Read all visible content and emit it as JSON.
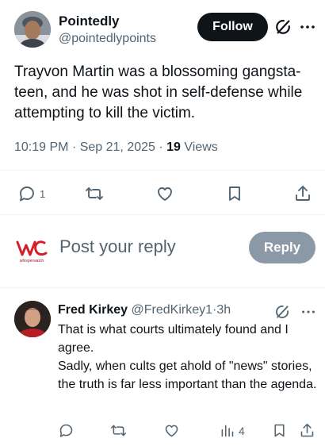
{
  "tweet": {
    "author_name": "Pointedly",
    "author_handle": "@pointedlypoints",
    "follow_label": "Follow",
    "text": "Trayvon Martin was a blossoming gangsta-teen, and he was shot in self-defense while attempting to kill the victim.",
    "time": "10:19 PM",
    "date": "Sep 21, 2025",
    "views_count": "19",
    "views_label": "Views",
    "reply_count": "1",
    "separator": "·"
  },
  "composer": {
    "placeholder": "Post your reply",
    "reply_button_label": "Reply",
    "logo_caption": "whisperwatch"
  },
  "reply": {
    "author_name": "Fred Kirkey",
    "author_handle": "@FredKirkey1",
    "time_ago": "3h",
    "separator": "·",
    "text_line1": "That is what courts ultimately found and I agree.",
    "text_line2": "Sadly, when cults get ahold of \"news\" stories, the truth is far less important than the agenda.",
    "views_count": "4"
  },
  "colors": {
    "text_primary": "#0f1419",
    "text_secondary": "#536471",
    "follow_bg": "#0f1419",
    "reply_btn_bg": "#8b98a5",
    "logo_red": "#d0202a"
  },
  "icons": {
    "main_actions": [
      "reply-icon",
      "retweet-icon",
      "like-icon",
      "bookmark-icon",
      "share-icon"
    ],
    "reply_actions": [
      "reply-icon",
      "retweet-icon",
      "like-icon",
      "views-icon",
      "bookmark-icon",
      "share-icon"
    ],
    "header": [
      "grok-icon",
      "more-icon"
    ]
  }
}
